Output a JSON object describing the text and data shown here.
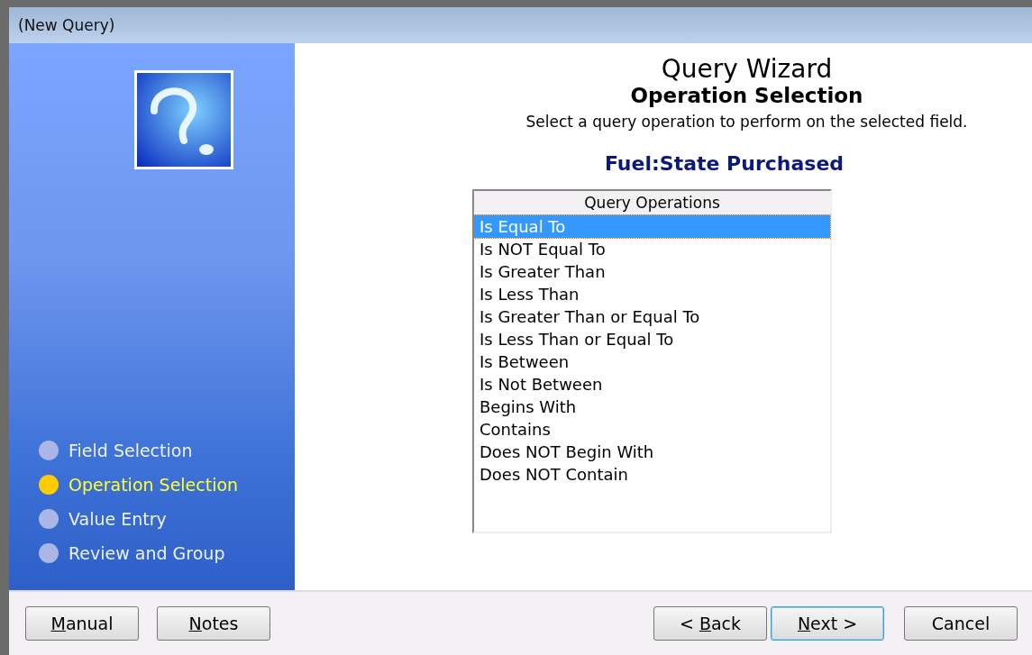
{
  "window": {
    "title": "(New Query)"
  },
  "steps": [
    {
      "label": "Field Selection",
      "selected": false
    },
    {
      "label": "Operation Selection",
      "selected": true
    },
    {
      "label": "Value Entry",
      "selected": false
    },
    {
      "label": "Review and Group",
      "selected": false
    }
  ],
  "header": {
    "title": "Query Wizard",
    "subtitle": "Operation Selection",
    "instruction": "Select a query operation to perform on the selected field.",
    "field": "Fuel:State Purchased"
  },
  "list": {
    "column": "Query Operations",
    "items": [
      {
        "label": "Is Equal To",
        "selected": true
      },
      {
        "label": "Is NOT Equal To",
        "selected": false
      },
      {
        "label": "Is Greater Than",
        "selected": false
      },
      {
        "label": "Is Less Than",
        "selected": false
      },
      {
        "label": "Is Greater Than or Equal To",
        "selected": false
      },
      {
        "label": "Is Less Than or Equal To",
        "selected": false
      },
      {
        "label": "Is Between",
        "selected": false
      },
      {
        "label": "Is Not Between",
        "selected": false
      },
      {
        "label": "Begins With",
        "selected": false
      },
      {
        "label": "Contains",
        "selected": false
      },
      {
        "label": "Does NOT Begin With",
        "selected": false
      },
      {
        "label": "Does NOT Contain",
        "selected": false
      }
    ]
  },
  "left_buttons": [
    {
      "key": "M",
      "post": "anual",
      "focused": false
    },
    {
      "key": "N",
      "post": "otes",
      "focused": false
    }
  ],
  "right_buttons": [
    {
      "pre": "< ",
      "key": "B",
      "post": "ack",
      "focused": false
    },
    {
      "key": "N",
      "post": "ext >",
      "focused": true
    },
    {
      "post": "Cancel",
      "focused": false
    }
  ]
}
